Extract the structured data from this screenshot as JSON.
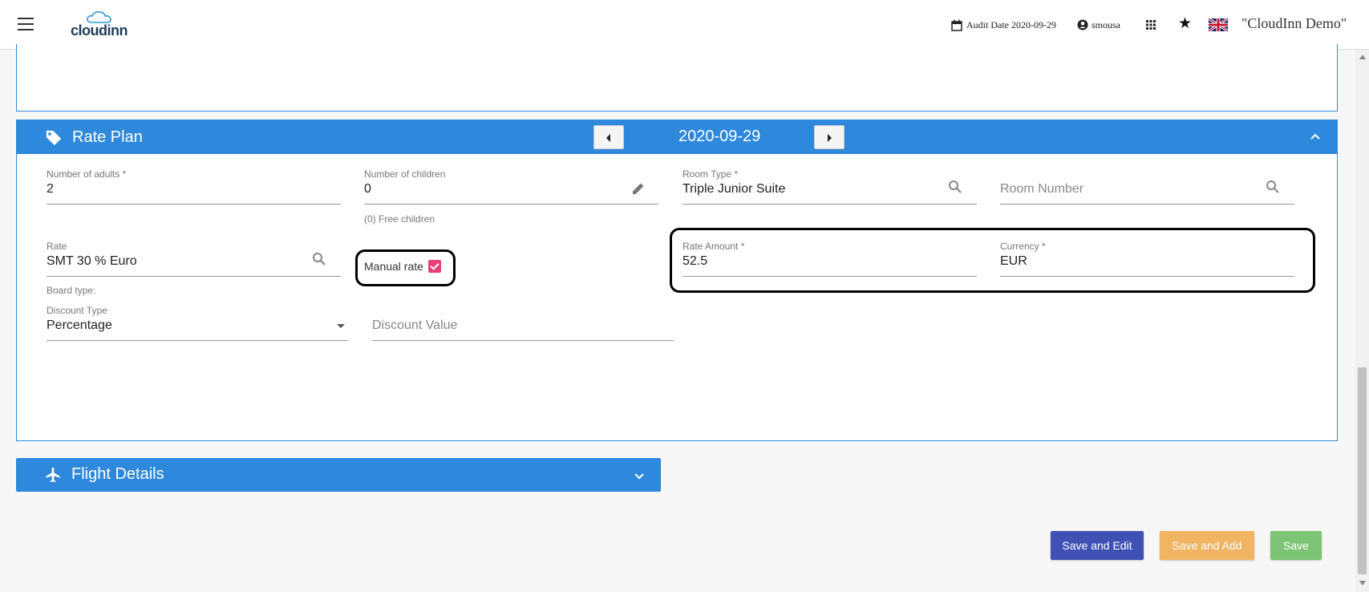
{
  "header": {
    "logo_text": "cloudinn",
    "audit_date": "Audit Date 2020-09-29",
    "user": "smousa",
    "hotel_name": "\"CloudInn Demo\""
  },
  "rate_plan": {
    "title": "Rate Plan",
    "date": "2020-09-29",
    "adults": {
      "label": "Number of adults *",
      "value": "2"
    },
    "children": {
      "label": "Number of children",
      "value": "0",
      "hint": "(0) Free children"
    },
    "room_type": {
      "label": "Room Type *",
      "value": "Triple Junior Suite"
    },
    "room_number": {
      "placeholder": "Room Number"
    },
    "rate": {
      "label": "Rate",
      "value": "SMT 30 % Euro"
    },
    "manual_rate": {
      "label": "Manual rate",
      "checked": true
    },
    "rate_amount": {
      "label": "Rate Amount *",
      "value": "52.5"
    },
    "currency": {
      "label": "Currency *",
      "value": "EUR"
    },
    "board_type": {
      "label": "Board type:"
    },
    "discount_type": {
      "label": "Discount Type",
      "value": "Percentage"
    },
    "discount_value": {
      "placeholder": "Discount Value"
    }
  },
  "flight_details": {
    "title": "Flight Details"
  },
  "buttons": {
    "save_and_edit": "Save and Edit",
    "save_and_add": "Save and Add",
    "save": "Save"
  },
  "colors": {
    "primary": "#2e88dc",
    "save_and_edit": "#3f51b5",
    "save_and_add": "#f0b562",
    "save": "#7dc474",
    "checkbox": "#e8407a"
  },
  "icons": {
    "menu": "menu-icon",
    "calendar": "calendar-icon",
    "user": "account-circle-icon",
    "apps": "apps-grid-icon",
    "star": "star-icon",
    "flag": "uk-flag-icon",
    "tag": "tag-icon",
    "pencil": "pencil-icon",
    "search": "search-icon",
    "plane": "airplane-icon"
  }
}
